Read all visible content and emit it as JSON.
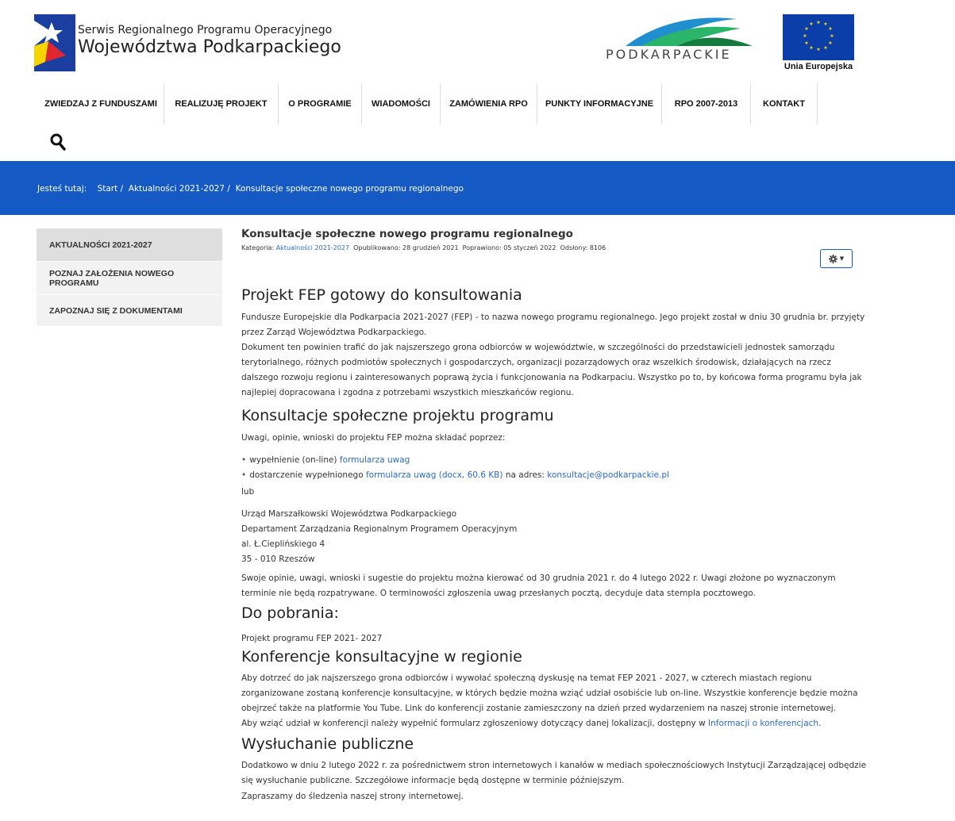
{
  "header": {
    "title_line1": "Serwis Regionalnego Programu Operacyjnego",
    "title_line2": "Województwa Podkarpackiego",
    "region_logo_text": "PODKARPACKIE",
    "eu_logo_text": "Unia Europejska"
  },
  "nav": {
    "items": [
      "ZWIEDZAJ Z FUNDUSZAMI",
      "REALIZUJĘ PROJEKT",
      "O PROGRAMIE",
      "WIADOMOŚCI",
      "ZAMÓWIENIA RPO",
      "PUNKTY INFORMACYJNE",
      "RPO 2007-2013",
      "KONTAKT"
    ],
    "search_icon": "search-icon"
  },
  "breadcrumb": {
    "label": "Jesteś tutaj:",
    "items": [
      "Start",
      "Aktualności 2021-2027",
      "Konsultacje społeczne nowego programu regionalnego"
    ],
    "separator": "/"
  },
  "sidebar": {
    "items": [
      "AKTUALNOŚCI 2021-2027",
      "POZNAJ ZAŁOŻENIA NOWEGO PROGRAMU",
      "ZAPOZNAJ SIĘ Z DOKUMENTAMI"
    ],
    "active_index": 0
  },
  "article": {
    "title": "Konsultacje społeczne nowego programu regionalnego",
    "meta": {
      "category_label": "Kategoria:",
      "category": "Aktualności 2021-2027",
      "published": "Opublikowano: 28 grudzień 2021",
      "modified": "Poprawiono: 05 styczeń 2022",
      "hits": "Odsłony: 8106"
    },
    "tools_icon": "gear-icon",
    "h_project": "Projekt FEP gotowy do konsultowania",
    "p1": "Fundusze Europejskie dla Podkarpacia 2021-2027 (FEP) - to nazwa nowego programu regionalnego. Jego projekt został w dniu 30 grudnia br. przyjęty przez Zarząd Województwa Podkarpackiego.",
    "p2": "Dokument ten powinien trafić do jak najszerszego grona odbiorców w województwie, w szczególności do przedstawicieli jednostek samorządu terytorialnego, różnych podmiotów społecznych i gospodarczych, organizacji pozarządowych oraz wszelkich środowisk, działających na rzecz dalszego rozwoju regionu i zainteresowanych poprawą życia i funkcjonowania na Podkarpaciu. Wszystko po to, by końcowa forma programu była jak najlepiej dopracowana i zgodna z potrzebami wszystkich mieszkańców regionu.",
    "h_consult": "Konsultacje społeczne projektu programu",
    "p3": "Uwagi, opinie, wnioski do projektu FEP można składać poprzez:",
    "li1_text": "wypełnienie (on-line) ",
    "li1_link": "formularza uwag",
    "li2_text": "dostarczenie wypełnionego ",
    "li2_link": "formularza uwag (docx, 60.6 KB)",
    "li2_mid": " na adres: ",
    "li2_email": "konsultacje@podkarpackie.pl",
    "lub": "lub",
    "address": [
      "Urząd Marszałkowski Województwa Podkarpackiego",
      "Departament Zarządzania Regionalnym Programem Operacyjnym",
      "al. Ł.Cieplińskiego 4",
      "35 - 010 Rzeszów"
    ],
    "p4": "Swoje opinie, uwagi, wnioski i sugestie do projektu można kierować od 30 grudnia 2021 r. do 4 lutego 2022 r. Uwagi złożone po wyznaczonym terminie nie będą rozpatrywane. O terminowości zgłoszenia uwag przesłanych pocztą, decyduje data stempla pocztowego.",
    "h_download": "Do pobrania:",
    "download_link": "Projekt programu FEP 2021- 2027",
    "h_conf": "Konferencje konsultacyjne w regionie",
    "p5": "Aby dotrzeć do jak najszerszego grona odbiorców i wywołać społeczną dyskusję na temat FEP 2021 - 2027, w czterech miastach regionu zorganizowane zostaną konferencje konsultacyjne, w których będzie można wziąć udział osobiście lub on-line. Wszystkie konferencje będzie można obejrzeć także na platformie You Tube. Link do konferencji zostanie zamieszczony na dzień przed wydarzeniem na naszej stronie internetowej.",
    "p6_text": "Aby wziąć udział w konferencji należy wypełnić formularz zgłoszeniowy dotyczący danej lokalizacji, dostępny w ",
    "p6_link": "Informacji o konferencjach",
    "p6_end": ".",
    "h_hearing": "Wysłuchanie publiczne",
    "p7": "Dodatkowo w dniu 2 lutego 2022 r. za pośrednictwem stron internetowych i kanałów w mediach społecznościowych Instytucji Zarządzającej odbędzie się wysłuchanie publiczne. Szczegółowe informacje będą dostępne w terminie późniejszym.",
    "p8": "Zapraszamy do śledzenia naszej strony internetowej."
  },
  "colors": {
    "banner": "#1559c4",
    "link": "#2a6ac9",
    "eu_blue": "#0b3ea8",
    "eu_star": "#ffdd00"
  }
}
